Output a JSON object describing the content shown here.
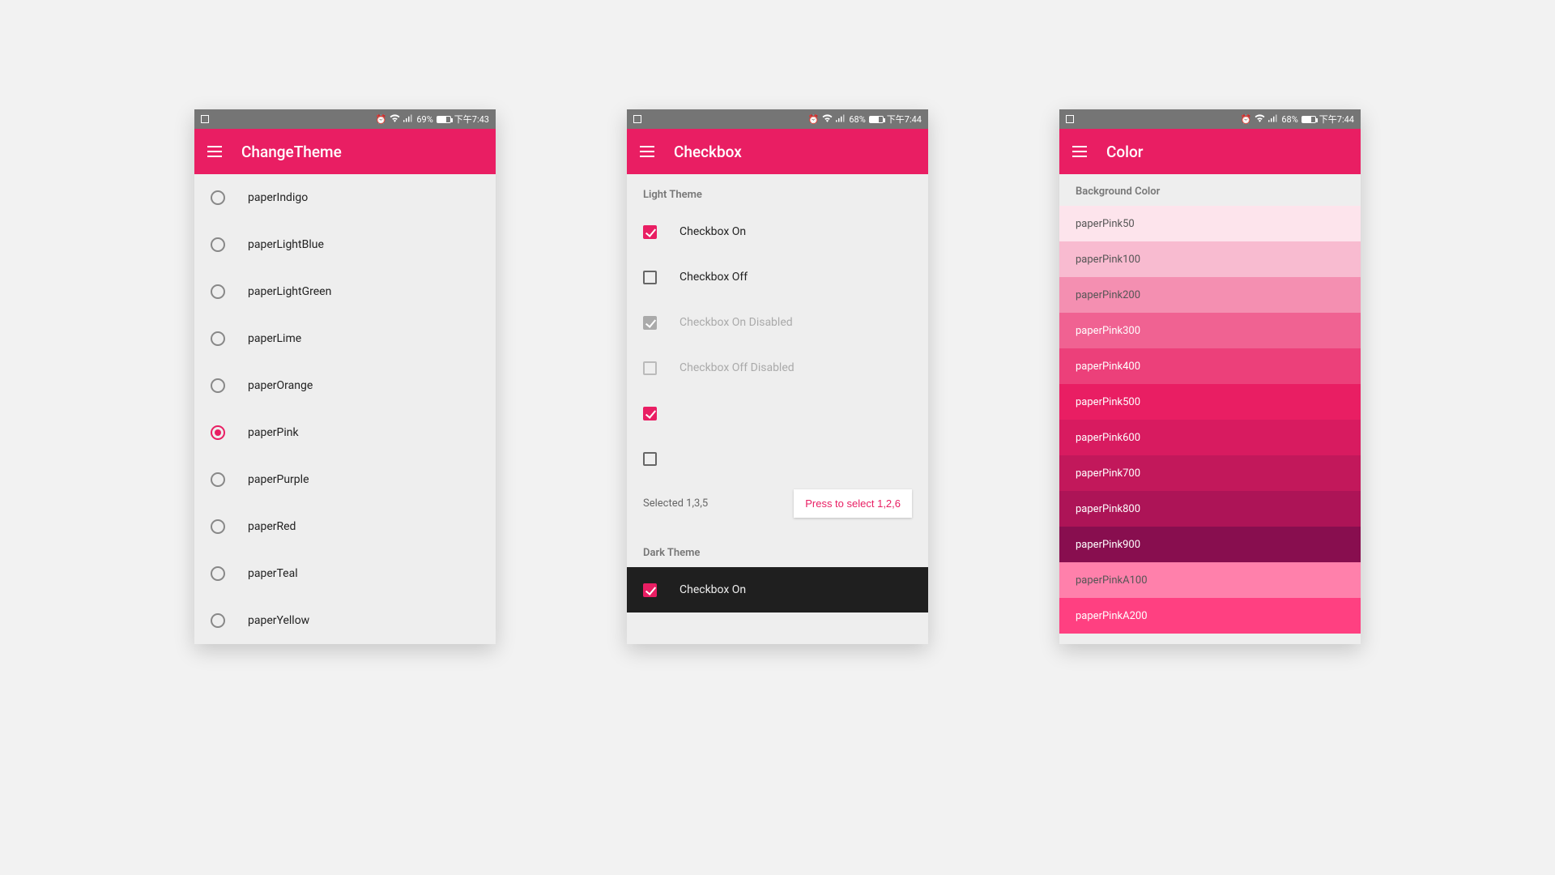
{
  "accent": "#e91e63",
  "phone1": {
    "status": {
      "battery": "69%",
      "time": "下午7:43"
    },
    "title": "ChangeTheme",
    "selected": "paperPink",
    "themes": [
      "paperIndigo",
      "paperLightBlue",
      "paperLightGreen",
      "paperLime",
      "paperOrange",
      "paperPink",
      "paperPurple",
      "paperRed",
      "paperTeal",
      "paperYellow"
    ]
  },
  "phone2": {
    "status": {
      "battery": "68%",
      "time": "下午7:44"
    },
    "title": "Checkbox",
    "light_header": "Light Theme",
    "dark_header": "Dark Theme",
    "items": [
      {
        "label": "Checkbox On",
        "checked": true,
        "disabled": false
      },
      {
        "label": "Checkbox Off",
        "checked": false,
        "disabled": false
      },
      {
        "label": "Checkbox On Disabled",
        "checked": true,
        "disabled": true
      },
      {
        "label": "Checkbox Off Disabled",
        "checked": false,
        "disabled": true
      },
      {
        "label": "",
        "checked": true,
        "disabled": false
      },
      {
        "label": "",
        "checked": false,
        "disabled": false
      }
    ],
    "selected_text": "Selected 1,3,5",
    "button_text": "Press to select 1,2,6",
    "dark_item": {
      "label": "Checkbox On",
      "checked": true
    }
  },
  "phone3": {
    "status": {
      "battery": "68%",
      "time": "下午7:44"
    },
    "title": "Color",
    "header": "Background Color",
    "swatches": [
      {
        "name": "paperPink50",
        "bg": "#fde4ec",
        "fg": "#555"
      },
      {
        "name": "paperPink100",
        "bg": "#f8bbd0",
        "fg": "#555"
      },
      {
        "name": "paperPink200",
        "bg": "#f48fb1",
        "fg": "#555"
      },
      {
        "name": "paperPink300",
        "bg": "#f06292",
        "fg": "#fff"
      },
      {
        "name": "paperPink400",
        "bg": "#ec407a",
        "fg": "#fff"
      },
      {
        "name": "paperPink500",
        "bg": "#e91e63",
        "fg": "#fff"
      },
      {
        "name": "paperPink600",
        "bg": "#d81b60",
        "fg": "#fff"
      },
      {
        "name": "paperPink700",
        "bg": "#c2185b",
        "fg": "#fff"
      },
      {
        "name": "paperPink800",
        "bg": "#ad1457",
        "fg": "#fff"
      },
      {
        "name": "paperPink900",
        "bg": "#880e4f",
        "fg": "#fff"
      },
      {
        "name": "paperPinkA100",
        "bg": "#ff80ab",
        "fg": "#555"
      },
      {
        "name": "paperPinkA200",
        "bg": "#ff4081",
        "fg": "#fff"
      }
    ]
  }
}
